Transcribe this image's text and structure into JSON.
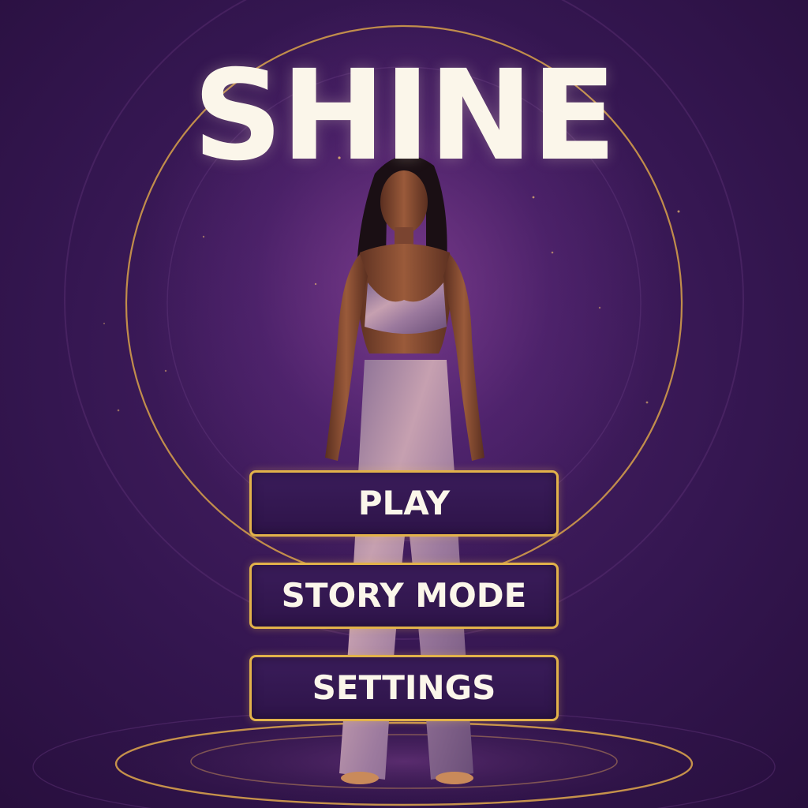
{
  "title": "SHINE",
  "menu": {
    "play_label": "PLAY",
    "story_mode_label": "STORY MODE",
    "settings_label": "SETTINGS"
  },
  "colors": {
    "background": "#341650",
    "accent_gold": "#e2b24a",
    "title_text": "#fbf6ea",
    "button_fill": "#2e1449"
  },
  "hero": {
    "image": "woman-in-metallic-outfit",
    "outfit_color": "#b08aa8"
  }
}
